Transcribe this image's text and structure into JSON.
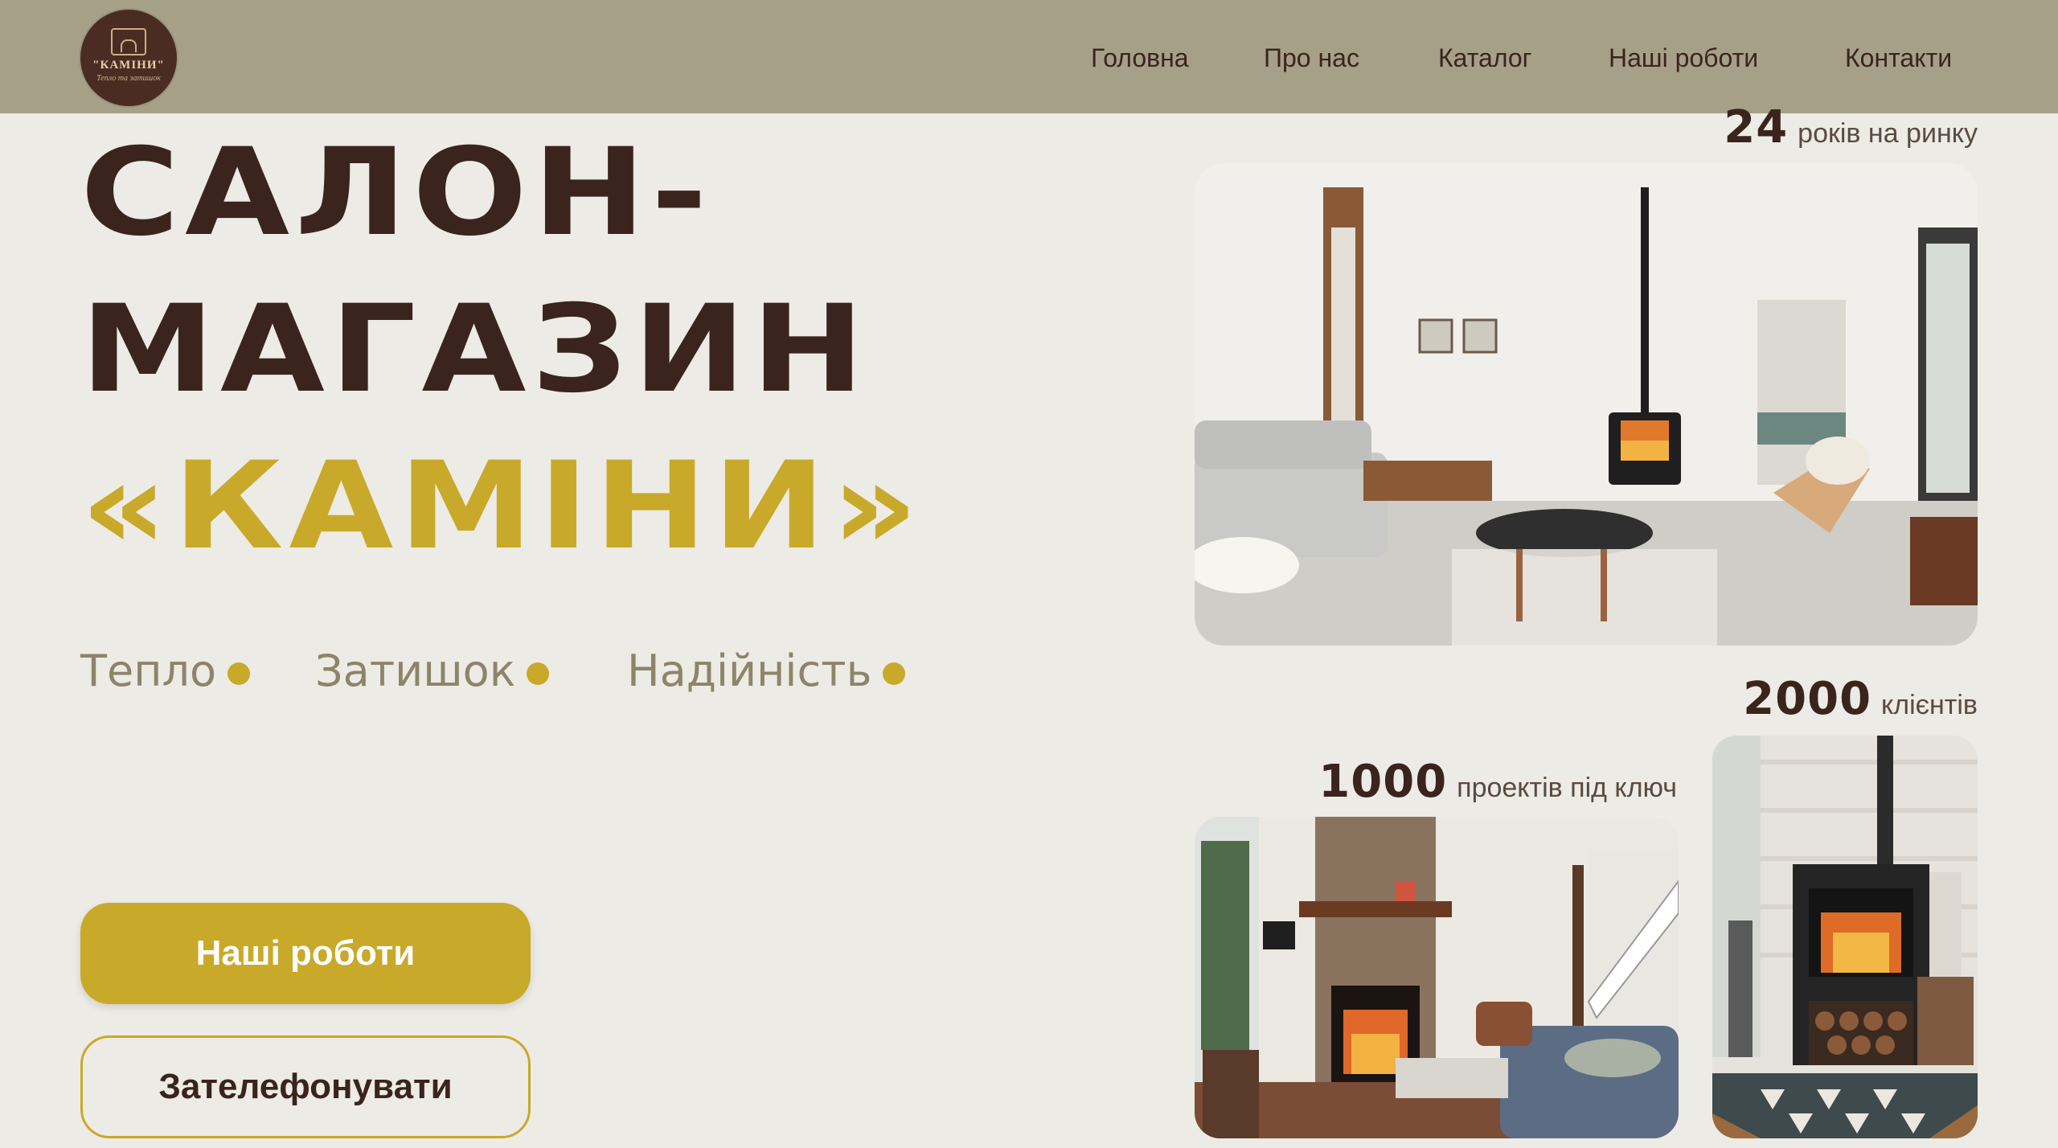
{
  "header": {
    "logo": {
      "name": "\"КАМІНИ\"",
      "tagline": "Тепло та затишок"
    },
    "nav": [
      {
        "label": "Головна"
      },
      {
        "label": "Про нас"
      },
      {
        "label": "Каталог"
      },
      {
        "label": "Наші роботи"
      },
      {
        "label": "Контакти"
      }
    ]
  },
  "hero": {
    "line1": "САЛОН-",
    "line2": "МАГАЗИН",
    "line3": "«КАМІНИ»",
    "features": [
      "Тепло",
      "Затишок",
      "Надійність"
    ],
    "primary_button": "Наші роботи",
    "secondary_button": "Зателефонувати"
  },
  "stats": [
    {
      "value": "24",
      "label": "років на ринку"
    },
    {
      "value": "2000",
      "label": "клієнтів"
    },
    {
      "value": "1000",
      "label": "проектів під ключ"
    }
  ],
  "colors": {
    "header_bg": "#a6a088",
    "page_bg": "#edebe5",
    "brand_dark": "#3a241d",
    "accent_gold": "#c9a92a",
    "feature_text": "#8c8569"
  }
}
